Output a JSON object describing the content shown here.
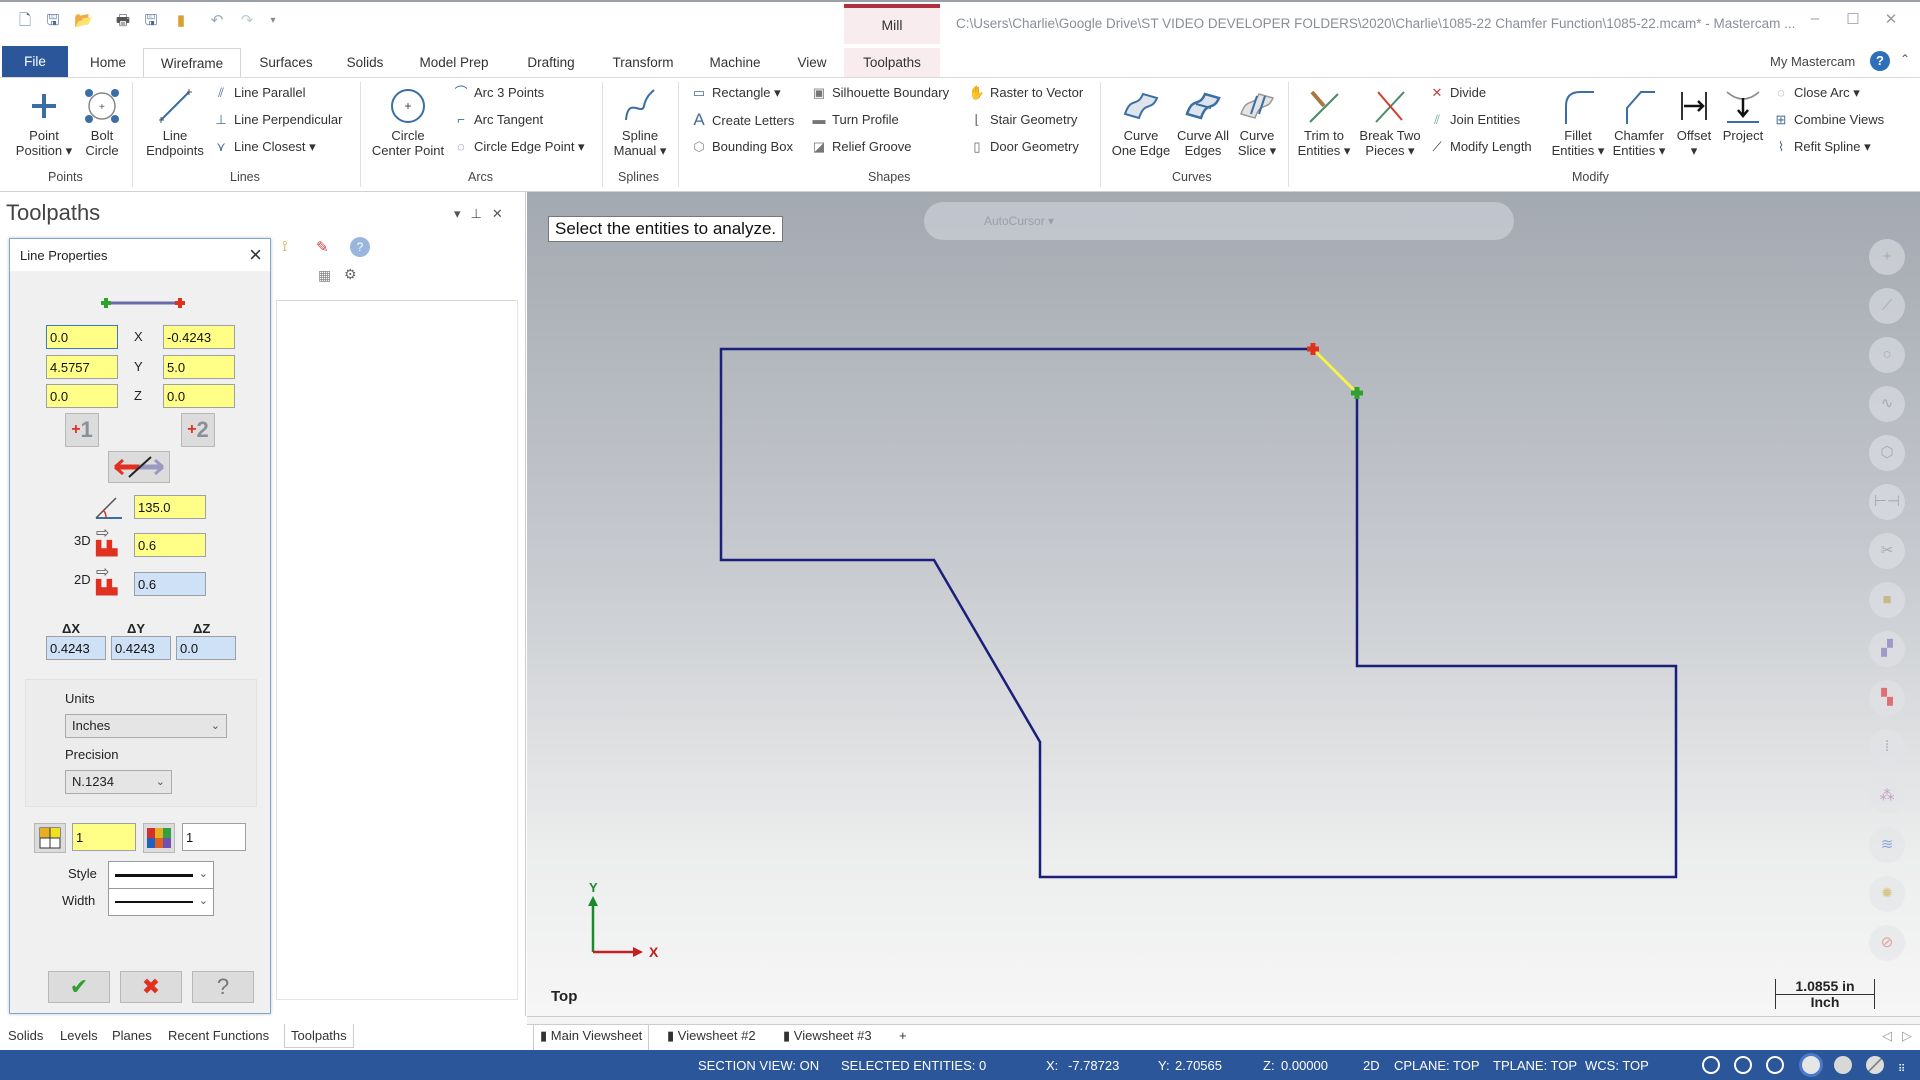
{
  "window": {
    "context_tab": "Mill",
    "title": "C:\\Users\\Charlie\\Google Drive\\ST VIDEO DEVELOPER FOLDERS\\2020\\Charlie\\1085-22 Chamfer Function\\1085-22.mcam* - Mastercam ...",
    "quick_access": [
      "new-file-icon",
      "save-icon",
      "open-icon",
      "print-icon",
      "save-as-icon",
      "folder-icon",
      "undo-icon",
      "redo-icon",
      "customize-icon"
    ],
    "controls": {
      "minimize": "–",
      "maximize": "☐",
      "close": "✕"
    }
  },
  "ribbon_tabs": [
    "File",
    "Home",
    "Wireframe",
    "Surfaces",
    "Solids",
    "Model Prep",
    "Drafting",
    "Transform",
    "Machine",
    "View",
    "Toolpaths"
  ],
  "active_tab": "Wireframe",
  "my_mastercam": "My Mastercam",
  "ribbon": {
    "groups": [
      "Points",
      "Lines",
      "Arcs",
      "Splines",
      "Shapes",
      "Curves",
      "Modify"
    ],
    "points": [
      {
        "l1": "Point",
        "l2": "Position ▾"
      },
      {
        "l1": "Bolt",
        "l2": "Circle"
      }
    ],
    "lines_big": {
      "l1": "Line",
      "l2": "Endpoints"
    },
    "lines_small": [
      "Line Parallel",
      "Line Perpendicular",
      "Line Closest ▾"
    ],
    "arcs_big": {
      "l1": "Circle",
      "l2": "Center Point"
    },
    "arcs_small": [
      "Arc 3 Points",
      "Arc Tangent",
      "Circle Edge Point ▾"
    ],
    "splines_big": {
      "l1": "Spline",
      "l2": "Manual ▾"
    },
    "shapes_col1": [
      "Rectangle ▾",
      "Create Letters",
      "Bounding Box"
    ],
    "shapes_col2": [
      "Silhouette Boundary",
      "Turn Profile",
      "Relief Groove"
    ],
    "shapes_col3": [
      "Raster to Vector",
      "Stair Geometry",
      "Door Geometry"
    ],
    "curves": [
      {
        "l1": "Curve",
        "l2": "One Edge"
      },
      {
        "l1": "Curve All",
        "l2": "Edges"
      },
      {
        "l1": "Curve",
        "l2": "Slice ▾"
      }
    ],
    "modify_big1": [
      {
        "l1": "Trim to",
        "l2": "Entities ▾"
      },
      {
        "l1": "Break Two",
        "l2": "Pieces ▾"
      }
    ],
    "modify_small1": [
      "Divide",
      "Join Entities",
      "Modify Length"
    ],
    "modify_big2": [
      {
        "l1": "Fillet",
        "l2": "Entities ▾"
      },
      {
        "l1": "Chamfer",
        "l2": "Entities ▾"
      },
      {
        "l1": "Offset",
        "l2": "▾"
      },
      {
        "l1": "Project",
        "l2": ""
      }
    ],
    "modify_small2": [
      "Close Arc ▾",
      "Combine Views",
      "Refit Spline ▾"
    ]
  },
  "left_panel": {
    "title": "Toolpaths",
    "controls": [
      "▾",
      "⊥",
      "✕"
    ],
    "bottom_tabs": [
      "Solids",
      "Levels",
      "Planes",
      "Recent Functions",
      "Toolpaths"
    ],
    "active_bottom_tab": "Toolpaths"
  },
  "dialog": {
    "title": "Line Properties",
    "point1": {
      "x": "0.0",
      "y": "4.5757",
      "z": "0.0"
    },
    "point2": {
      "x": "-0.4243",
      "y": "5.0",
      "z": "0.0"
    },
    "axis_labels": [
      "X",
      "Y",
      "Z"
    ],
    "point1_button": "1",
    "point2_button": "2",
    "angle": "135.0",
    "length_3d_label": "3D",
    "length_3d": "0.6",
    "length_2d_label": "2D",
    "length_2d": "0.6",
    "delta_labels": [
      "ΔX",
      "ΔY",
      "ΔZ"
    ],
    "deltas": [
      "0.4243",
      "0.4243",
      "0.0"
    ],
    "units_label": "Units",
    "units": "Inches",
    "precision_label": "Precision",
    "precision": "N.1234",
    "level": "1",
    "color": "1",
    "style_label": "Style",
    "width_label": "Width",
    "ok": "✔",
    "cancel": "✖",
    "help": "?"
  },
  "viewport": {
    "prompt": "Select the entities to analyze.",
    "autocursor_label": "AutoCursor ▾",
    "view_name": "Top",
    "axis_x": "X",
    "axis_y": "Y",
    "scale_value": "1.0855 in",
    "scale_unit": "Inch",
    "geometry_color": "#1a1f7a",
    "selected_line_color": "#f2f24a",
    "start_point_color": "#e03020",
    "end_point_color": "#30a030",
    "right_toolbar": [
      "add-point-icon",
      "line-icon",
      "circle-icon",
      "spline-icon",
      "solid-icon",
      "dimension-icon",
      "trim-icon",
      "box-icon",
      "copy-icon",
      "move-icon",
      "xform-icon",
      "snap-icon",
      "layers-icon",
      "settings-icon",
      "blank-icon"
    ]
  },
  "viewsheets": {
    "tabs": [
      "Main Viewsheet",
      "Viewsheet #2",
      "Viewsheet #3"
    ],
    "add": "+"
  },
  "status_bar": {
    "section_view": "SECTION VIEW: ON",
    "selected": "SELECTED ENTITIES: 0",
    "x_label": "X:",
    "x": "-7.78723",
    "y_label": "Y:",
    "y": "2.70565",
    "z_label": "Z:",
    "z": "0.00000",
    "mode": "2D",
    "cplane": "CPLANE: TOP",
    "tplane": "TPLANE: TOP",
    "wcs": "WCS: TOP"
  }
}
